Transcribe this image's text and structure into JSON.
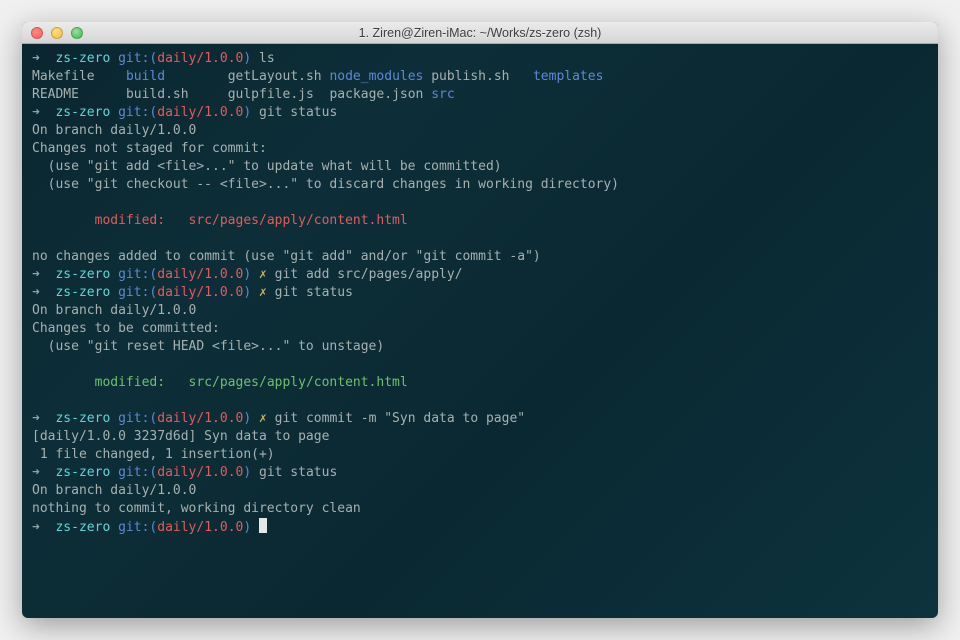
{
  "window": {
    "title": "1. Ziren@Ziren-iMac: ~/Works/zs-zero (zsh)"
  },
  "prompt": {
    "arrow": "➜",
    "dir": "zs-zero",
    "git_label": "git:(",
    "git_close": ")",
    "branch": "daily/1.0.0",
    "dirty": "✗"
  },
  "cmd": {
    "ls": "ls",
    "status1": "git status",
    "add": "git add src/pages/apply/",
    "status2": "git status",
    "commit": "git commit -m \"Syn data to page\"",
    "status3": "git status"
  },
  "ls": {
    "c1a": "Makefile",
    "c2a": "build",
    "c3a": "getLayout.sh",
    "c4a": "node_modules",
    "c5a": "publish.sh",
    "c6a": "templates",
    "c1b": "README",
    "c2b": "build.sh",
    "c3b": "gulpfile.js",
    "c4b": "package.json",
    "c5b": "src"
  },
  "status1": {
    "branch": "On branch daily/1.0.0",
    "heading": "Changes not staged for commit:",
    "hint1": "  (use \"git add <file>...\" to update what will be committed)",
    "hint2": "  (use \"git checkout -- <file>...\" to discard changes in working directory)",
    "mod_label": "        modified:   ",
    "mod_file": "src/pages/apply/content.html",
    "footer": "no changes added to commit (use \"git add\" and/or \"git commit -a\")"
  },
  "status2": {
    "branch": "On branch daily/1.0.0",
    "heading": "Changes to be committed:",
    "hint1": "  (use \"git reset HEAD <file>...\" to unstage)",
    "mod_label": "        modified:   ",
    "mod_file": "src/pages/apply/content.html"
  },
  "commit_out": {
    "l1": "[daily/1.0.0 3237d6d] Syn data to page",
    "l2": " 1 file changed, 1 insertion(+)"
  },
  "status3": {
    "branch": "On branch daily/1.0.0",
    "clean": "nothing to commit, working directory clean"
  }
}
